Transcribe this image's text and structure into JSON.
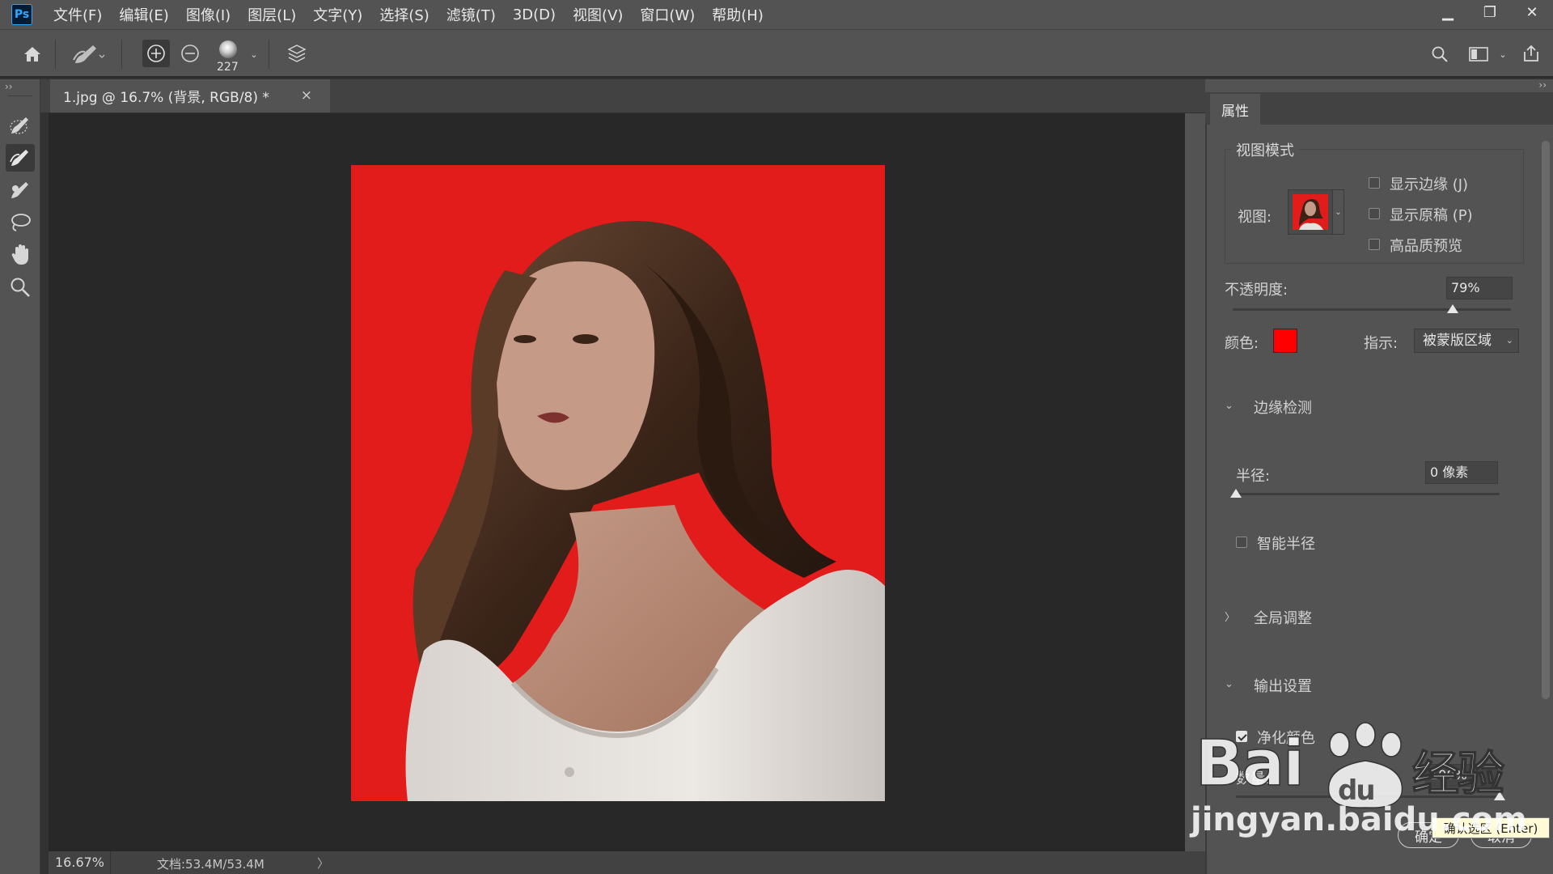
{
  "app": {
    "logo": "Ps"
  },
  "menu": [
    "文件(F)",
    "编辑(E)",
    "图像(I)",
    "图层(L)",
    "文字(Y)",
    "选择(S)",
    "滤镜(T)",
    "3D(D)",
    "视图(V)",
    "窗口(W)",
    "帮助(H)"
  ],
  "window": {
    "minimize": "▁",
    "restore": "❐",
    "close": "✕"
  },
  "options": {
    "brush_size": "227"
  },
  "document": {
    "tab_title": "1.jpg @ 16.7% (背景, RGB/8) *",
    "tab_close": "×",
    "zoom": "16.67%",
    "doc_info": "文档:53.4M/53.4M",
    "status_arrow": "〉"
  },
  "tools": [
    {
      "name": "quick-selection-tool",
      "active": false
    },
    {
      "name": "refine-edge-brush-tool",
      "active": true
    },
    {
      "name": "brush-tool",
      "active": false
    },
    {
      "name": "lasso-tool",
      "active": false
    },
    {
      "name": "hand-tool",
      "active": false
    },
    {
      "name": "zoom-tool",
      "active": false
    }
  ],
  "properties": {
    "tab": "属性",
    "view_mode_legend": "视图模式",
    "view_label": "视图:",
    "show_edge": "显示边缘 (J)",
    "show_original": "显示原稿 (P)",
    "high_quality_preview": "高品质预览",
    "opacity_label": "不透明度:",
    "opacity_value": "79%",
    "opacity_level": 79,
    "color_label": "颜色:",
    "overlay_color": "#ff0000",
    "indicate_label": "指示:",
    "indicate_value": "被蒙版区域",
    "edge_detection": "边缘检测",
    "radius_label": "半径:",
    "radius_value": "0 像素",
    "radius_level": 0,
    "smart_radius": "智能半径",
    "global_refinements": "全局调整",
    "output_settings": "输出设置",
    "decontaminate": "净化颜色",
    "amount_label": "数量:",
    "amount_value": "100%",
    "amount_level": 100,
    "ok": "确定",
    "cancel": "取消",
    "tooltip": "确认选区 (Enter)"
  },
  "watermark": {
    "logo": "Bai du 经验",
    "url": "jingyan.baidu.com"
  }
}
